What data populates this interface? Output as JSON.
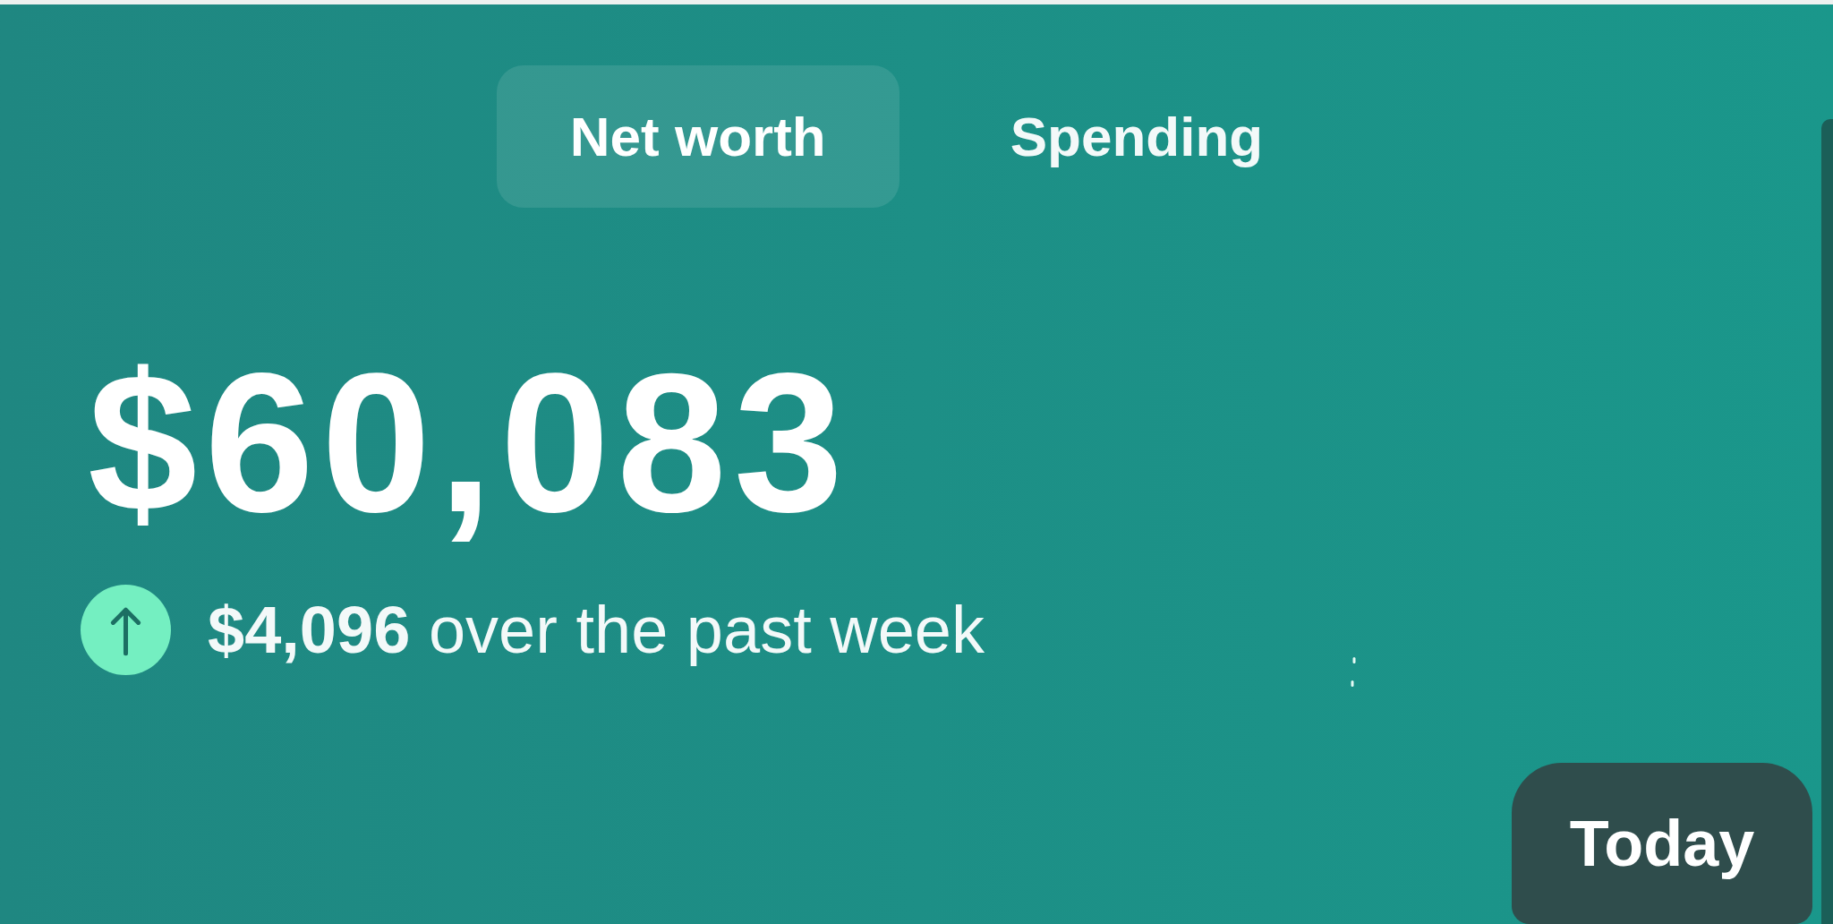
{
  "tabs": [
    {
      "label": "Net worth",
      "selected": true
    },
    {
      "label": "Spending",
      "selected": false
    }
  ],
  "balance": {
    "amount": "$60,083"
  },
  "change": {
    "increased": true,
    "text": "**$4,096** over the past week"
  },
  "today_button": {
    "label": "Today"
  }
}
